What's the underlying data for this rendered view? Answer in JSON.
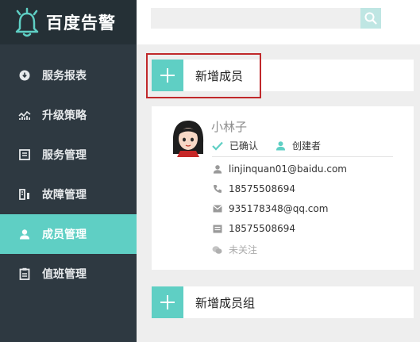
{
  "app": {
    "name": "百度告警"
  },
  "sidebar": {
    "items": [
      {
        "label": "服务报表",
        "icon": "download-circle-icon",
        "active": false
      },
      {
        "label": "升级策略",
        "icon": "trend-chart-icon",
        "active": false
      },
      {
        "label": "服务管理",
        "icon": "list-box-icon",
        "active": false
      },
      {
        "label": "故障管理",
        "icon": "fault-bars-icon",
        "active": false
      },
      {
        "label": "成员管理",
        "icon": "person-icon",
        "active": true
      },
      {
        "label": "值班管理",
        "icon": "clipboard-icon",
        "active": false
      }
    ]
  },
  "search": {
    "placeholder": "",
    "icon": "search-icon"
  },
  "actions": {
    "add_member": "新增成员",
    "add_group": "新增成员组"
  },
  "member": {
    "name": "小林子",
    "confirmed": "已确认",
    "role": "创建者",
    "email": "linjinquan01@baidu.com",
    "phone": "18575508694",
    "qq": "935178348@qq.com",
    "sms": "18575508694",
    "wechat": "未关注"
  },
  "colors": {
    "accent": "#5fcfc4",
    "sidebar": "#2e3941",
    "highlight": "#c0292b"
  }
}
